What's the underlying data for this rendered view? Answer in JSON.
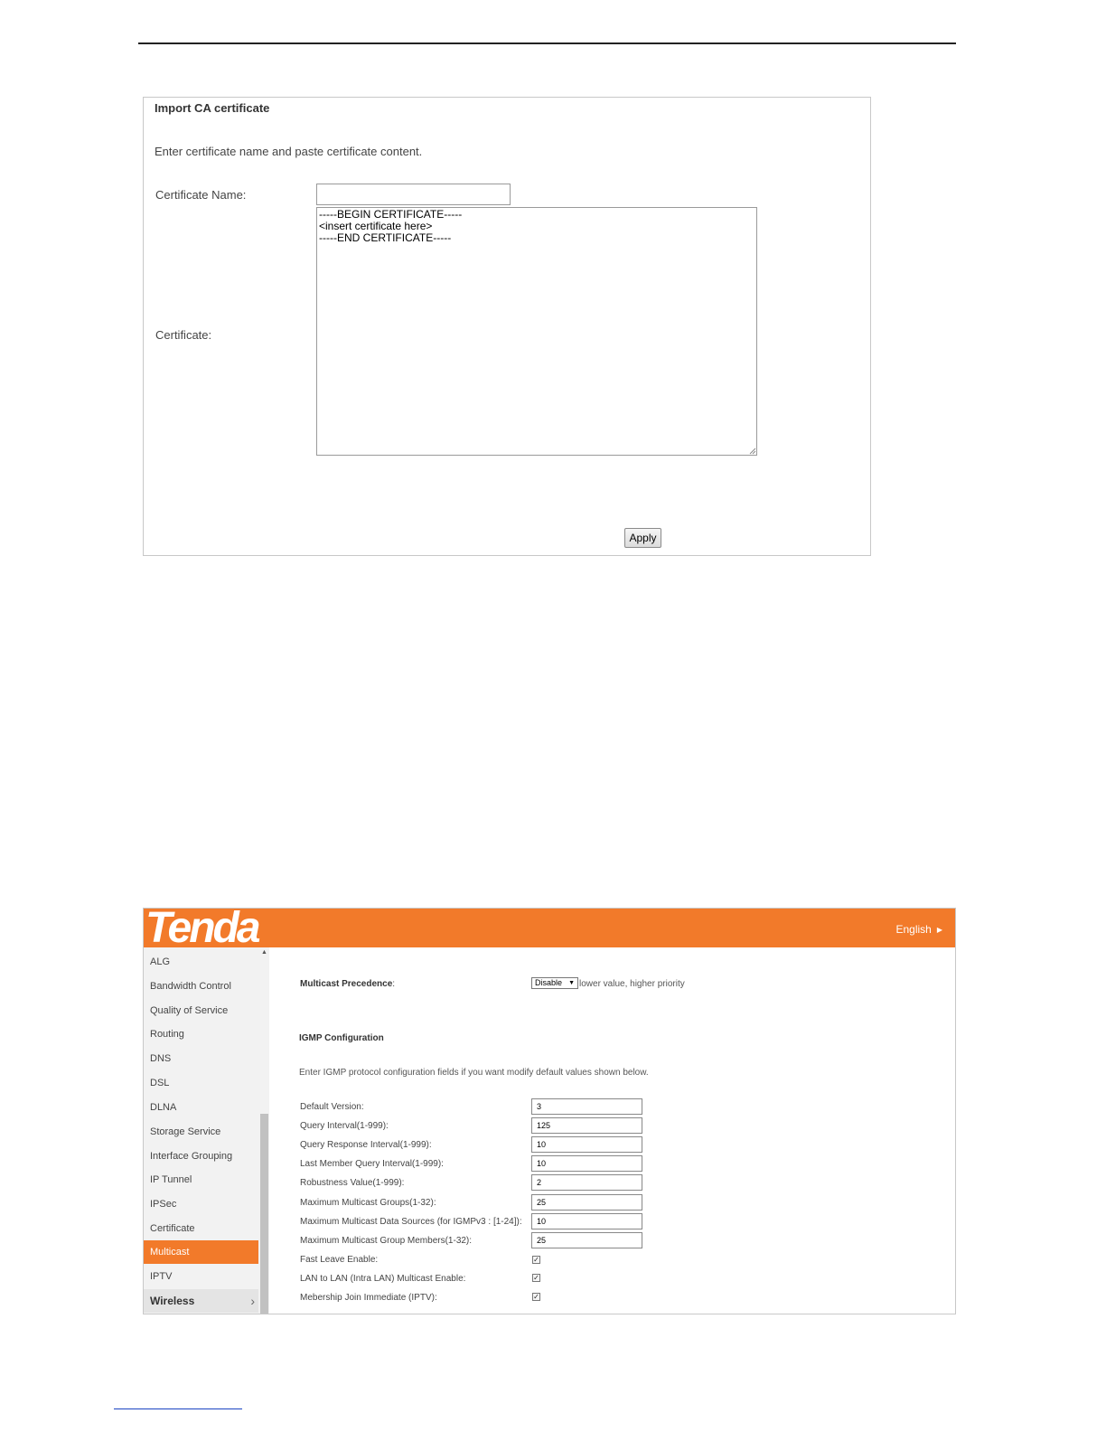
{
  "ca_import": {
    "title": "Import CA certificate",
    "description": "Enter certificate name and paste certificate content.",
    "name_label": "Certificate Name:",
    "name_value": "",
    "cert_label": "Certificate:",
    "cert_value": "-----BEGIN CERTIFICATE-----\n<insert certificate here>\n-----END CERTIFICATE-----",
    "apply_label": "Apply"
  },
  "tenda": {
    "brand": "Tenda",
    "language": "English",
    "accent_color": "#f27a2a",
    "sidebar": {
      "items": [
        {
          "label": "ALG"
        },
        {
          "label": "Bandwidth Control"
        },
        {
          "label": "Quality of Service"
        },
        {
          "label": "Routing"
        },
        {
          "label": "DNS"
        },
        {
          "label": "DSL"
        },
        {
          "label": "DLNA"
        },
        {
          "label": "Storage Service"
        },
        {
          "label": "Interface Grouping"
        },
        {
          "label": "IP Tunnel"
        },
        {
          "label": "IPSec"
        },
        {
          "label": "Certificate"
        },
        {
          "label": "Multicast",
          "active": true
        },
        {
          "label": "IPTV"
        }
      ],
      "group": "Wireless"
    },
    "multicast": {
      "precedence_label": "Multicast Precedence",
      "precedence_colon": ":",
      "precedence_value": "Disable",
      "precedence_note": "lower value, higher priority",
      "igmp_title": "IGMP Configuration",
      "igmp_desc": "Enter IGMP protocol configuration fields if you want modify default values shown below.",
      "fields": [
        {
          "label": "Default Version:",
          "value": "3"
        },
        {
          "label": "Query Interval(1-999):",
          "value": "125"
        },
        {
          "label": "Query Response Interval(1-999):",
          "value": "10"
        },
        {
          "label": "Last Member Query Interval(1-999):",
          "value": "10"
        },
        {
          "label": "Robustness Value(1-999):",
          "value": "2"
        },
        {
          "label": "Maximum Multicast Groups(1-32):",
          "value": "25"
        },
        {
          "label": "Maximum Multicast Data Sources (for IGMPv3 : [1-24]):",
          "value": "10"
        },
        {
          "label": "Maximum Multicast Group Members(1-32):",
          "value": "25"
        }
      ],
      "checks": [
        {
          "label": "Fast Leave Enable:",
          "checked": true
        },
        {
          "label": "LAN to LAN (Intra LAN) Multicast Enable:",
          "checked": true
        },
        {
          "label": "Mebership Join Immediate (IPTV):",
          "checked": true
        }
      ]
    }
  }
}
